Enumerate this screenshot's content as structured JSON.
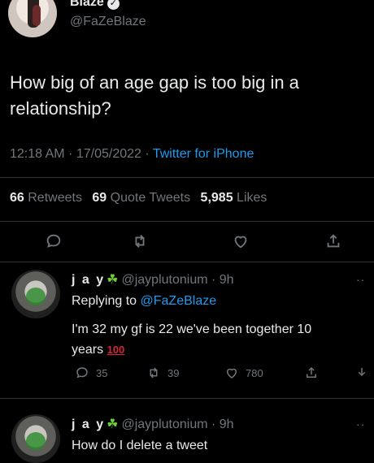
{
  "author": {
    "name": "Blaze",
    "handle": "@FaZeBlaze"
  },
  "tweet": {
    "text_line1": "How big of an age gap is too big in a",
    "text_line2": "relationship?",
    "time": "12:18 AM",
    "date": "17/05/2022",
    "source": "Twitter for iPhone"
  },
  "stats": {
    "retweets": "66",
    "retweets_label": "Retweets",
    "quotes": "69",
    "quotes_label": "Quote Tweets",
    "likes": "5,985",
    "likes_label": "Likes"
  },
  "actions": [
    "reply-icon",
    "retweet-icon",
    "like-icon",
    "share-icon"
  ],
  "replies": [
    {
      "name": "j a y",
      "handle": "@jayplutonium · 9h",
      "replying_label": "Replying to",
      "replying_to": "@FaZeBlaze",
      "text_line1": "I'm 32 my gf is 22 we've been together 10",
      "text_line2": "years",
      "emoji": "100",
      "counts": {
        "replies": "35",
        "retweets": "39",
        "likes": "780"
      }
    },
    {
      "name": "j a y",
      "handle": "@jayplutonium · 9h",
      "text_line1": "How do I delete a tweet"
    }
  ],
  "colors": {
    "background": "#000000",
    "text": "#e7e9ea",
    "muted": "#71767b",
    "link": "#1d9bf0"
  }
}
